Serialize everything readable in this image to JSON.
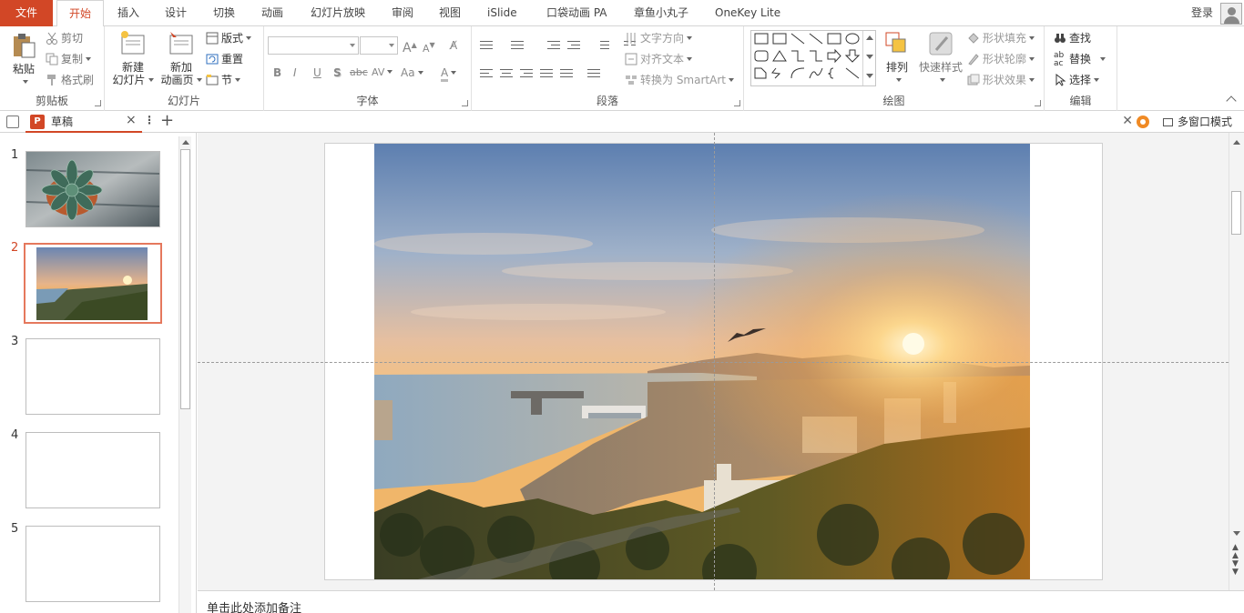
{
  "tabs": [
    {
      "label": "文件",
      "x": 0
    },
    {
      "label": "开始",
      "active": true
    },
    {
      "label": "插入"
    },
    {
      "label": "设计"
    },
    {
      "label": "切换"
    },
    {
      "label": "动画"
    },
    {
      "label": "幻灯片放映"
    },
    {
      "label": "审阅"
    },
    {
      "label": "视图"
    },
    {
      "label": "iSlide"
    },
    {
      "label": "口袋动画 PA"
    },
    {
      "label": "章鱼小丸子"
    },
    {
      "label": "OneKey Lite"
    }
  ],
  "login_label": "登录",
  "ribbon": {
    "clipboard": {
      "group": "剪贴板",
      "paste": "粘贴",
      "cut": "剪切",
      "copy": "复制",
      "format_painter": "格式刷"
    },
    "slides": {
      "group": "幻灯片",
      "new_slide_line1": "新建",
      "new_slide_line2": "幻灯片",
      "new_anim_line1": "新加",
      "new_anim_line2": "动画页",
      "layout": "版式",
      "reset": "重置",
      "section": "节"
    },
    "font": {
      "group": "字体",
      "bold": "B",
      "italic": "I",
      "underline": "U",
      "shadow": "S",
      "strike": "abc",
      "spacing": "AV",
      "case": "Aa",
      "color": "A",
      "grow": "A",
      "shrink": "A"
    },
    "paragraph": {
      "group": "段落",
      "text_direction": "文字方向",
      "align_text": "对齐文本",
      "smartart": "转换为 SmartArt"
    },
    "drawing": {
      "group": "绘图",
      "arrange": "排列",
      "quick_styles": "快速样式",
      "shape_fill": "形状填充",
      "shape_outline": "形状轮廓",
      "shape_effects": "形状效果"
    },
    "editing": {
      "group": "编辑",
      "find": "查找",
      "replace": "替换",
      "select": "选择"
    }
  },
  "document": {
    "title": "草稿",
    "multi_window": "多窗口模式"
  },
  "slides": [
    {
      "number": "1"
    },
    {
      "number": "2",
      "selected": true
    },
    {
      "number": "3"
    },
    {
      "number": "4"
    },
    {
      "number": "5"
    }
  ],
  "notes_placeholder": "单击此处添加备注",
  "colors": {
    "accent": "#d24726",
    "selection": "#e5785d"
  }
}
